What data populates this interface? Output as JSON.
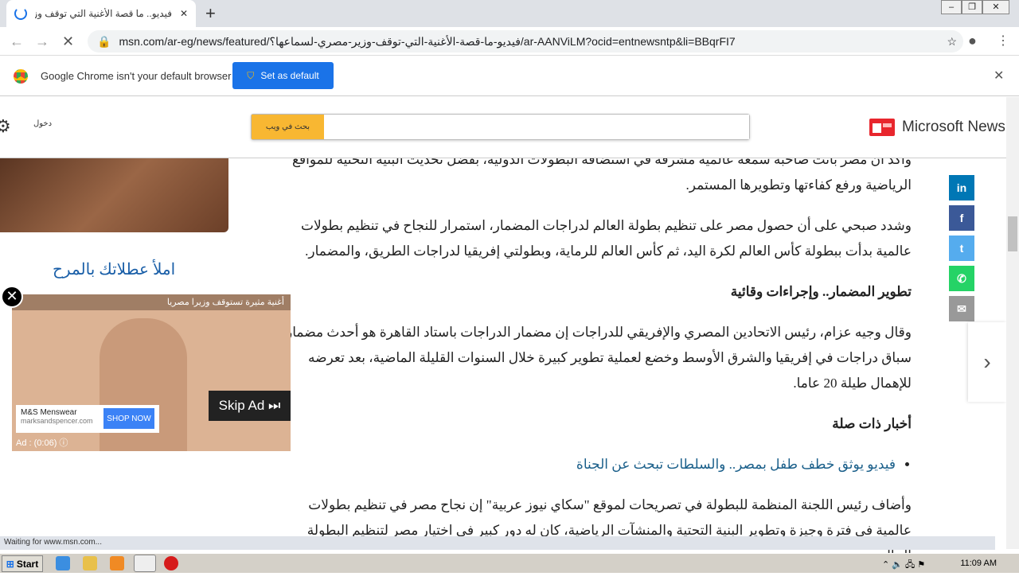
{
  "browser": {
    "tab_title": "فيديو.. ما قصة الأغنية التي توقف وزير",
    "url": "msn.com/ar-eg/news/featured/فيديو-ما-قصة-الأغنية-التي-توقف-وزير-مصري-لسماعها؟/ar-AANViLM?ocid=entnewsntp&li=BBqrFI7",
    "infobar_text": "Google Chrome isn't your default browser",
    "set_default_label": "Set as default",
    "status_text": "Waiting for www.msn.com..."
  },
  "header": {
    "brand": "Microsoft News",
    "search_button": "بحث في ويب",
    "search_value": "",
    "signin": "دخول"
  },
  "article": {
    "paragraphs": [
      "وأكد أن مصر باتت صاحبة سمعة عالمية مشرفة في استضافة البطولات الدولية، بفضل تحديث البنية التحتية للمواقع الرياضية ورفع كفاءتها وتطويرها المستمر.",
      "وشدد صبحي على أن حصول مصر على تنظيم بطولة العالم لدراجات المضمار، استمرار للنجاح في تنظيم بطولات عالمية بدأت ببطولة كأس العالم لكرة اليد، ثم كأس العالم للرماية، وبطولتي إفريقيا لدراجات الطريق، والمضمار."
    ],
    "heading1": "تطوير المضمار.. وإجراءات وقائية",
    "paragraph3": "وقال وجيه عزام، رئيس الاتحادين المصري والإفريقي للدراجات إن مضمار الدراجات باستاد القاهرة هو أحدث مضمار سباق دراجات في إفريقيا والشرق الأوسط وخضع لعملية تطوير كبيرة خلال السنوات القليلة الماضية، بعد تعرضه للإهمال طيلة 20 عاما.",
    "related_heading": "أخبار ذات صلة",
    "related_link": "فيديو يوثق خطف طفل بمصر.. والسلطات تبحث عن الجناة",
    "paragraph4": "وأضاف رئيس اللجنة المنظمة للبطولة في تصريحات لموقع \"سكاي نيوز عربية\" إن نجاح مصر في تنظيم بطولات عالمية في فترة وجيزة وتطوير البنية التحتية والمنشآت الرياضية، كان له دور كبير في اختيار مصر لتنظيم البطولة الحالية من بين"
  },
  "sidebar": {
    "promo_title": "املأ عطلاتك بالمرح"
  },
  "ad": {
    "title": "أغنية مثيرة تستوقف وزيرا مصريا",
    "advertiser": "M&S Menswear",
    "domain": "marksandspencer.com",
    "cta": "SHOP NOW",
    "skip": "Skip Ad",
    "timer": "Ad : (0:06)"
  },
  "share": [
    {
      "icon": "linkedin-icon",
      "color": "#0077b5",
      "glyph": "in"
    },
    {
      "icon": "facebook-icon",
      "color": "#3b5998",
      "glyph": "f"
    },
    {
      "icon": "twitter-icon",
      "color": "#55acee",
      "glyph": "t"
    },
    {
      "icon": "whatsapp-icon",
      "color": "#25d366",
      "glyph": "✆"
    },
    {
      "icon": "email-icon",
      "color": "#999999",
      "glyph": "✉"
    }
  ],
  "taskbar": {
    "start": "Start",
    "clock": "11:09 AM"
  }
}
